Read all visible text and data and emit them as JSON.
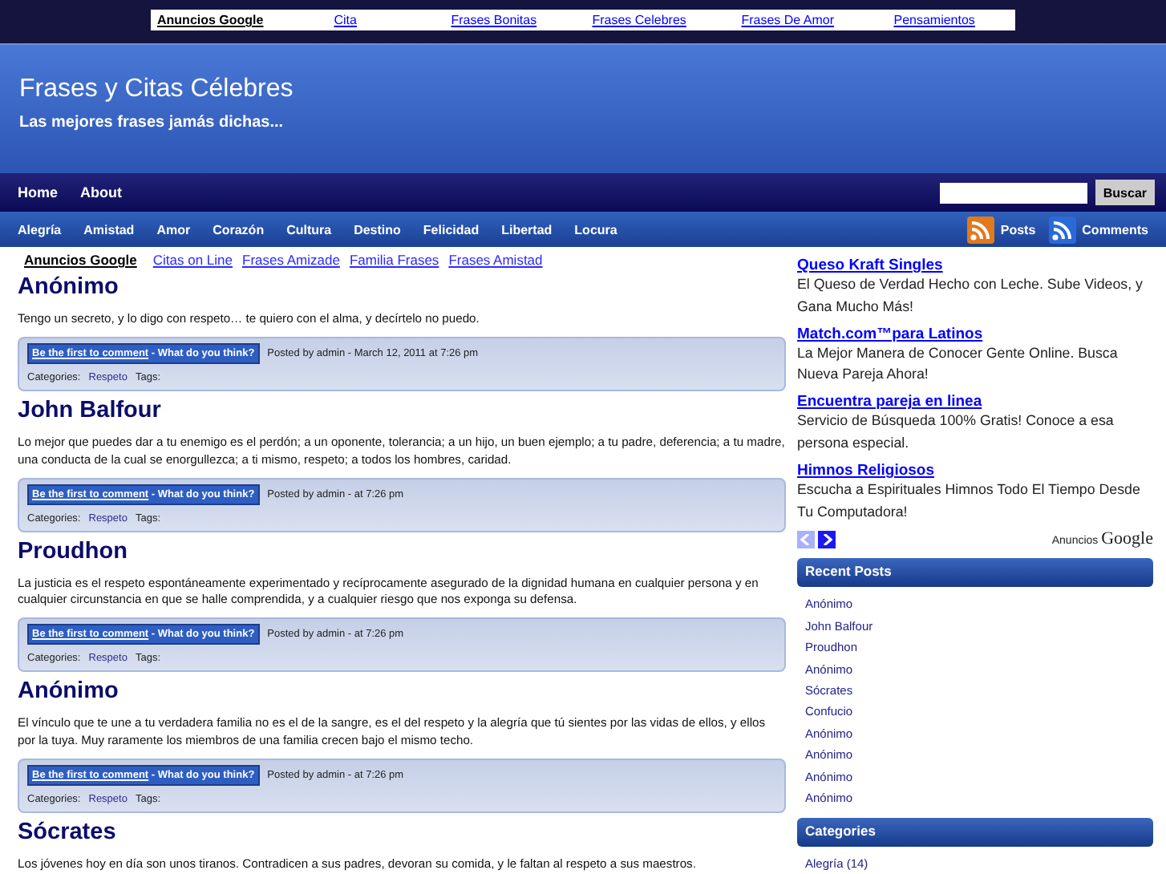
{
  "top_ads": {
    "label": "Anuncios Google",
    "links": [
      "Cita",
      "Frases Bonitas",
      "Frases Celebres",
      "Frases De Amor",
      "Pensamientos"
    ]
  },
  "header": {
    "title": "Frases y Citas Célebres",
    "tagline": "Las mejores frases jamás dichas..."
  },
  "nav": {
    "items": [
      "Home",
      "About"
    ],
    "search": {
      "button": "Buscar"
    }
  },
  "categories_bar": {
    "items": [
      "Alegría",
      "Amistad",
      "Amor",
      "Corazón",
      "Cultura",
      "Destino",
      "Felicidad",
      "Libertad",
      "Locura"
    ],
    "feeds": [
      "Posts",
      "Comments"
    ]
  },
  "content_ads": {
    "label": "Anuncios Google",
    "links": [
      "Citas on Line",
      "Frases Amizade",
      "Familia Frases",
      "Frases Amistad"
    ]
  },
  "posts": [
    {
      "title": "Anónimo",
      "text": "Tengo un secreto, y lo digo con respeto… te quiero con el alma, y decírtelo no puedo.",
      "comment_link": "Be the first to comment",
      "comment_prompt": " - What do you think?",
      "posted": "Posted by admin - March 12, 2011 at 7:26 pm",
      "categories_label": "Categories:",
      "category": "Respeto",
      "tags_label": "Tags:"
    },
    {
      "title": "John Balfour",
      "text": "Lo mejor que puedes dar a tu enemigo es el perdón; a un oponente, tolerancia; a un hijo, un buen ejemplo; a tu padre, deferencia; a tu madre, una conducta de la cual se enorgullezca; a ti mismo, respeto; a todos los hombres, caridad.",
      "comment_link": "Be the first to comment",
      "comment_prompt": " - What do you think?",
      "posted": "Posted by admin - at 7:26 pm",
      "categories_label": "Categories:",
      "category": "Respeto",
      "tags_label": "Tags:"
    },
    {
      "title": "Proudhon",
      "text": "La justicia es el respeto espontáneamente experimentado y recíprocamente asegurado de la dignidad humana en cualquier persona y en cualquier circunstancia en que se halle comprendida, y a cualquier riesgo que nos exponga su defensa.",
      "comment_link": "Be the first to comment",
      "comment_prompt": " - What do you think?",
      "posted": "Posted by admin - at 7:26 pm",
      "categories_label": "Categories:",
      "category": "Respeto",
      "tags_label": "Tags:"
    },
    {
      "title": "Anónimo",
      "text": "El vínculo que te une a tu verdadera familia no es el de la sangre, es el del respeto y la alegría que tú sientes por las vidas de ellos, y ellos por la tuya. Muy raramente los miembros de una familia crecen bajo el mismo techo.",
      "comment_link": "Be the first to comment",
      "comment_prompt": " - What do you think?",
      "posted": "Posted by admin - at 7:26 pm",
      "categories_label": "Categories:",
      "category": "Respeto",
      "tags_label": "Tags:"
    },
    {
      "title": "Sócrates",
      "text": "Los jóvenes hoy en día son unos tiranos. Contradicen a sus padres, devoran su comida, y le faltan al respeto a sus maestros."
    }
  ],
  "sidebar_ads": {
    "items": [
      {
        "title": "Queso Kraft Singles",
        "text": "El Queso de Verdad Hecho con Leche. Sube Videos, y Gana Mucho Más!"
      },
      {
        "title": "Match.com™para Latinos",
        "text": "La Mejor Manera de Conocer Gente Online. Busca Nueva Pareja Ahora!"
      },
      {
        "title": "Encuentra pareja en linea",
        "text": "Servicio de Búsqueda 100% Gratis! Conoce a esa persona especial."
      },
      {
        "title": "Himnos Religiosos",
        "text": "Escucha a Espirituales Himnos Todo El Tiempo Desde Tu Computadora!"
      }
    ],
    "prev_disabled": true,
    "label": "Anuncios",
    "brand": "Google"
  },
  "widgets": [
    {
      "title": "Recent Posts",
      "items": [
        "Anónimo",
        "John Balfour",
        "Proudhon",
        "Anónimo",
        "Sócrates",
        "Confucio",
        "Anónimo",
        "Anónimo",
        "Anónimo",
        "Anónimo"
      ]
    },
    {
      "title": "Categories",
      "items": [
        "Alegría (14)"
      ]
    }
  ]
}
